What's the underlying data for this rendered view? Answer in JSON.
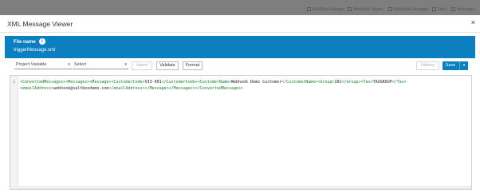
{
  "background_toolbar": {
    "items": [
      "Workflow Settings",
      "Workflow Trigger",
      "Workflow Debugger",
      "Files",
      "Messages"
    ]
  },
  "modal": {
    "title": "XML Message Viewer",
    "close_icon": "×",
    "file_label": "File name",
    "file_name": "triggerMessage.xml"
  },
  "toolbar": {
    "project_variable_value": "Project Variable",
    "select_value": "Select",
    "insert_label": "Insert",
    "validate_label": "Validate",
    "format_label": "Format",
    "history_label": "History",
    "save_label": "Save"
  },
  "editor": {
    "line_number": "1",
    "line1": {
      "t1": "<ConvertedMessages><Messages><Message><CustomerCode>",
      "v1": "V33-001",
      "t2": "</CustomerCode><CustomerName>",
      "v2": "Webhook Demo Customer",
      "t3": "</CustomerName><Group>",
      "v3": "101",
      "t4": "</Group><Tax>",
      "v4": "TAXGROUP",
      "t5": "</Tax>"
    },
    "line2": {
      "t1": "<emailAddress>",
      "v1": "webhook@saltboxdemo.com",
      "t2": "</emailAddress></Message></Messages></ConvertedMessages>"
    }
  },
  "colors": {
    "accent": "#0c7fc0",
    "xml_tag": "#11852a"
  }
}
